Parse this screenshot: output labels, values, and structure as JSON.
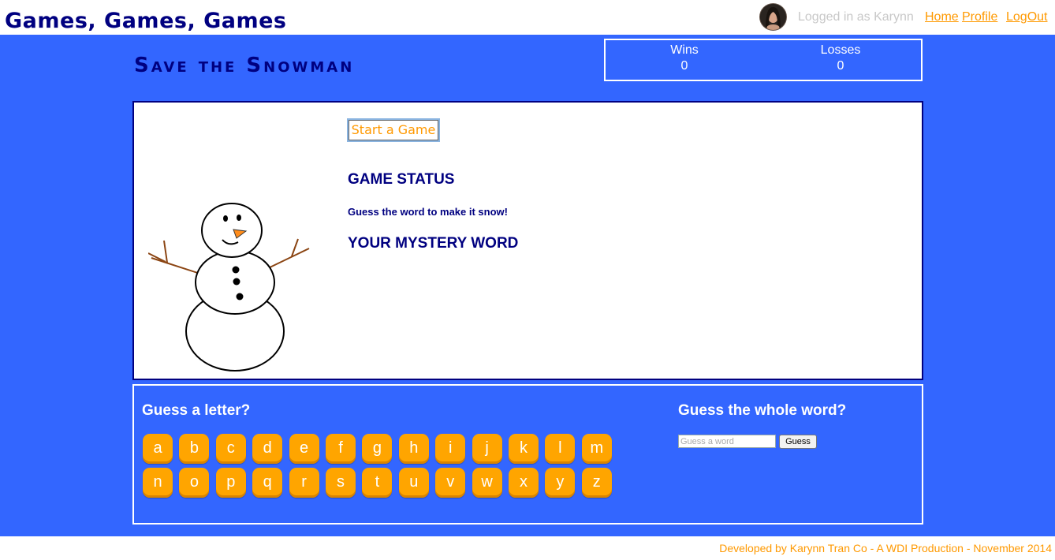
{
  "header": {
    "site_title": "Games, Games, Games",
    "logged_in_text": "Logged in as Karynn",
    "nav": {
      "home": "Home",
      "profile": "Profile",
      "logout": "LogOut"
    }
  },
  "game": {
    "title": "Save the Snowman",
    "score": {
      "wins_label": "Wins",
      "wins": "0",
      "losses_label": "Losses",
      "losses": "0"
    },
    "start_button": "Start a Game",
    "status_heading": "GAME STATUS",
    "status_text": "Guess the word to make it snow!",
    "mystery_heading": "YOUR MYSTERY WORD"
  },
  "guess": {
    "letter_heading": "Guess a letter?",
    "letters": [
      "a",
      "b",
      "c",
      "d",
      "e",
      "f",
      "g",
      "h",
      "i",
      "j",
      "k",
      "l",
      "m",
      "n",
      "o",
      "p",
      "q",
      "r",
      "s",
      "t",
      "u",
      "v",
      "w",
      "x",
      "y",
      "z"
    ],
    "word_heading": "Guess the whole word?",
    "word_placeholder": "Guess a word",
    "guess_button": "Guess"
  },
  "footer": {
    "text": "Developed by Karynn Tran Co - A WDI Production - November 2014"
  },
  "colors": {
    "background": "#3366ff",
    "navy": "#000080",
    "accent": "#ff9900",
    "letter_button": "#ffa500"
  }
}
